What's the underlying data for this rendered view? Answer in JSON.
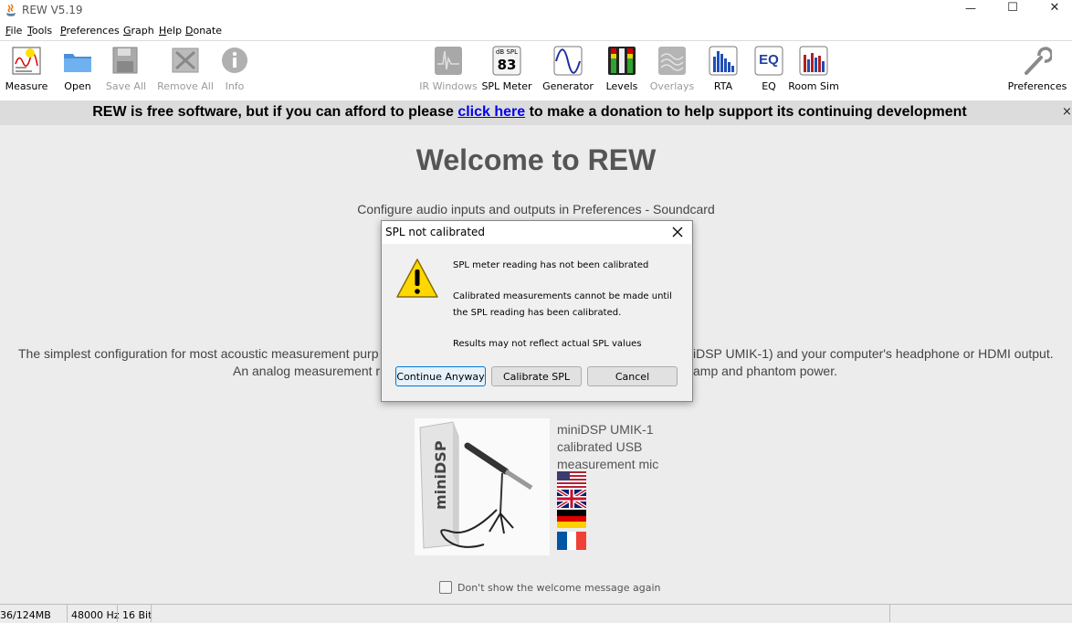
{
  "window": {
    "title": "REW V5.19",
    "min_glyph": "—",
    "max_glyph": "☐",
    "close_glyph": "✕"
  },
  "menu": [
    "File",
    "Tools",
    "Preferences",
    "Graph",
    "Help",
    "Donate"
  ],
  "toolbar": {
    "measure": "Measure",
    "open": "Open",
    "save_all": "Save All",
    "remove_all": "Remove All",
    "info": "Info",
    "ir_windows": "IR Windows",
    "spl_meter": "SPL Meter",
    "spl_icon_unit": "dB SPL",
    "spl_icon_value": "83",
    "generator": "Generator",
    "levels": "Levels",
    "overlays": "Overlays",
    "rta": "RTA",
    "eq": "EQ",
    "eq_icon_text": "EQ",
    "room_sim": "Room Sim",
    "preferences": "Preferences"
  },
  "banner": {
    "before": "REW is free software, but if you can afford to please ",
    "link": "click here",
    "after": " to make a donation to help support its continuing development",
    "close": "×"
  },
  "welcome": {
    "title": "Welcome to REW",
    "configure": "Configure audio inputs and outputs in Preferences - Soundcard",
    "line1_left": "The simplest configuration for most acoustic measurement purp",
    "line1_right": "iDSP UMIK-1) and your computer's headphone or HDMI output.",
    "line2_left": "An analog measurement r",
    "line2_right": "amp and phantom power.",
    "mic_caption": [
      "miniDSP UMIK-1",
      "calibrated USB",
      "measurement mic"
    ],
    "dont_show": "Don't show the welcome message again"
  },
  "status": {
    "memory": "36/124MB",
    "sample_rate": "48000 Hz",
    "bit_depth": "16 Bit"
  },
  "dialog": {
    "title": "SPL not calibrated",
    "message1": "SPL meter reading has not been calibrated",
    "message2": "Calibrated measurements cannot be made until",
    "message3": "the SPL reading has been calibrated.",
    "message4": "Results may not reflect actual SPL values",
    "continue_label": "Continue Anyway",
    "calibrate_label": "Calibrate SPL",
    "cancel_label": "Cancel"
  },
  "colors": {
    "link": "#0000ee",
    "focus_border": "#0078d7",
    "warning_fill": "#ffd800"
  }
}
